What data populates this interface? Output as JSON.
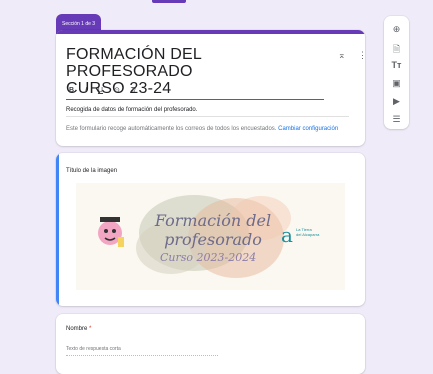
{
  "header": {
    "section_tab": "Sección 1 de 3",
    "title_line1": "FORMACIÓN DEL PROFESORADO",
    "title_line2": "CURSO 23-24",
    "format_buttons": [
      "B",
      "I",
      "U",
      "⊙",
      "T̸"
    ],
    "description": "Recogida de datos de formación del profesorado.",
    "notice": "Este formulario recoge automáticamente los correos de todos los encuestados.",
    "notice_link": "Cambiar configuración"
  },
  "toolbar": {
    "icons": [
      "add-question",
      "import-questions",
      "add-title",
      "add-image",
      "add-video",
      "add-section"
    ]
  },
  "image_item": {
    "title": "Título de la imagen",
    "banner_text": "Formación del profesorado",
    "banner_sub": "Curso 2023-2024",
    "logo_line1": "La Tierra",
    "logo_line2": "del Alcaparra"
  },
  "question": {
    "title": "Nombre",
    "required_mark": "*",
    "placeholder": "Texto de respuesta corta"
  },
  "colors": {
    "accent": "#673ab7",
    "background": "#f0ebf8",
    "active": "#4285f4"
  }
}
